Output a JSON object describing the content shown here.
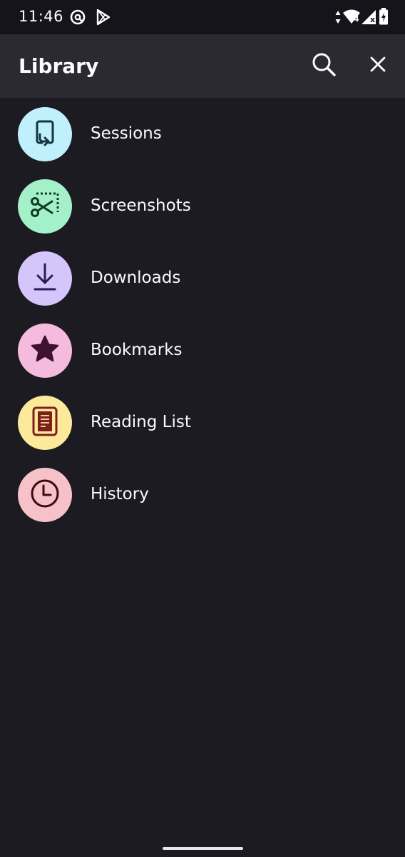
{
  "status_bar": {
    "time": "11:46",
    "left_icons": [
      "at-sign-icon",
      "play-store-icon"
    ],
    "right_icons": [
      "data-arrows-icon",
      "wifi-icon",
      "cell-signal-icon",
      "battery-charging-icon"
    ],
    "wifi_badge": "4",
    "signal_badge": "x"
  },
  "toolbar": {
    "title": "Library",
    "search_icon": "search-icon",
    "close_icon": "close-icon"
  },
  "items": [
    {
      "label": "Sessions",
      "icon": "sessions-icon",
      "circle_color": "#c0f0fc",
      "icon_color": "#14343e"
    },
    {
      "label": "Screenshots",
      "icon": "scissors-icon",
      "circle_color": "#a4f1c9",
      "icon_color": "#0f3b26"
    },
    {
      "label": "Downloads",
      "icon": "download-icon",
      "circle_color": "#d6c5fb",
      "icon_color": "#2a1a57"
    },
    {
      "label": "Bookmarks",
      "icon": "star-icon",
      "circle_color": "#f5bbde",
      "icon_color": "#3f1233"
    },
    {
      "label": "Reading List",
      "icon": "reading-list-icon",
      "circle_color": "#fde99a",
      "icon_color": "#7d1f1f"
    },
    {
      "label": "History",
      "icon": "clock-icon",
      "circle_color": "#f7c1ca",
      "icon_color": "#3b0b0b"
    }
  ],
  "colors": {
    "background": "#1c1b22",
    "toolbar": "#2b2a33",
    "status_bar": "#15141a",
    "text": "#fbfbfe"
  }
}
